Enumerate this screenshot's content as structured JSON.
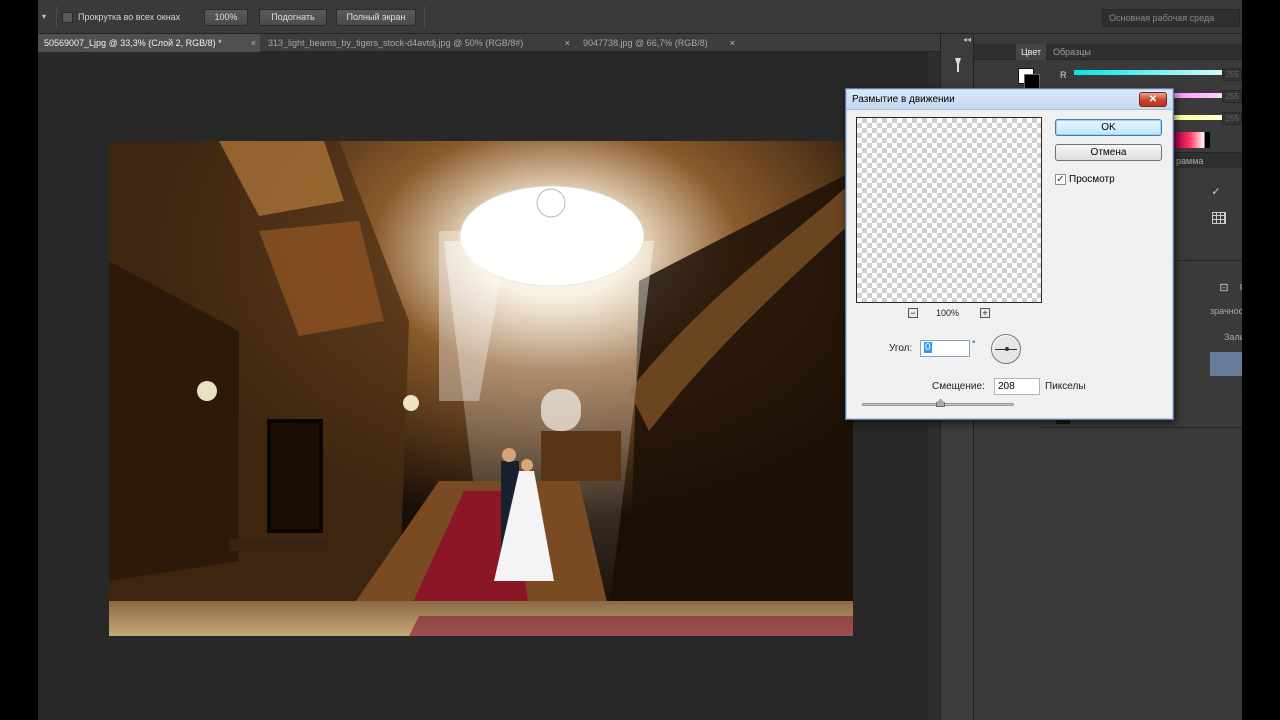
{
  "options_bar": {
    "scroll_all_label": "Прокрутка во всех окнах",
    "btn_100": "100%",
    "btn_fit": "Подогнать",
    "btn_fullscreen": "Полный экран",
    "workspace": "Основная рабочая среда"
  },
  "tabs": [
    {
      "label": "50569007_Ljpg @ 33,3% (Слой 2, RGB/8) *",
      "close": "×",
      "active": true
    },
    {
      "label": "313_light_beams_by_tigers_stock-d4avtdj.jpg @ 50% (RGB/8#)",
      "close": "×",
      "active": false
    },
    {
      "label": "9047738.jpg @ 66,7% (RGB/8)",
      "close": "×",
      "active": false
    }
  ],
  "panels": {
    "tab_color": "Цвет",
    "tab_swatches": "Образцы",
    "channel_r": "R",
    "values": [
      "255",
      "255",
      "255"
    ],
    "gamma_fragment": "рамма",
    "opacity_fragment": "зрачность:",
    "fill_fragment": "Заливка:",
    "collapse_icon": "◂◂"
  },
  "dialog": {
    "title": "Размытие в движении",
    "close": "✕",
    "ok": "OK",
    "cancel": "Отмена",
    "preview_label": "Просмотр",
    "preview_checked": "✓",
    "zoom": "100%",
    "zoom_out": "−",
    "zoom_in": "+",
    "angle_label": "Угол:",
    "angle_value": "0",
    "degree": "°",
    "offset_label": "Смещение:",
    "offset_value": "208",
    "offset_unit": "Пикселы"
  },
  "colors": {
    "slider_r": "#39c8d2",
    "dialog_accent": "#5c7ba8",
    "layer_selected": "#687c99"
  }
}
